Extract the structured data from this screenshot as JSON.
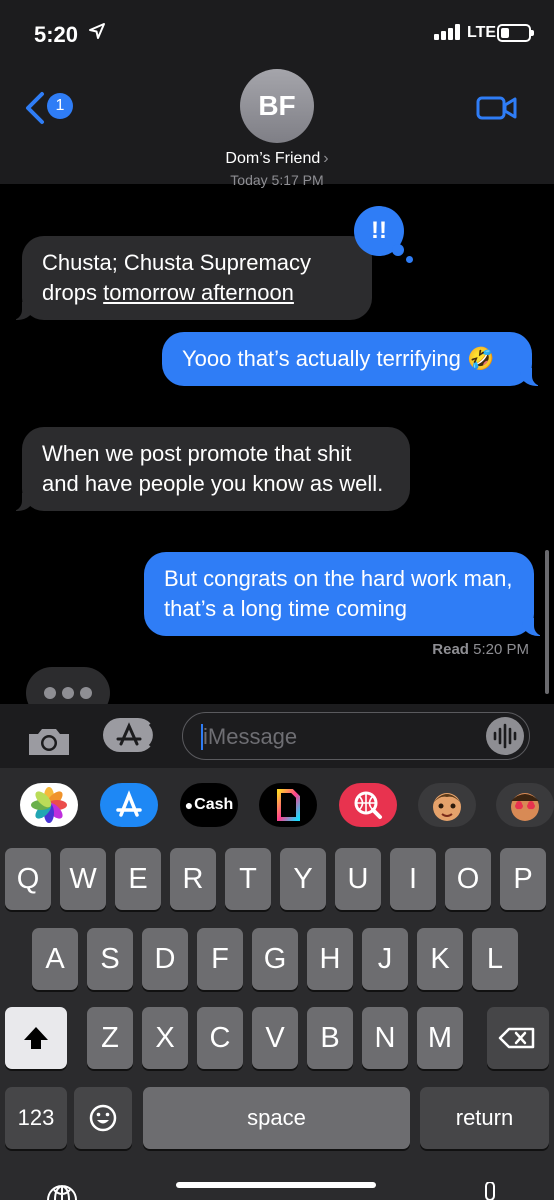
{
  "status_bar": {
    "time": "5:20",
    "network": "LTE"
  },
  "header": {
    "back_badge": "1",
    "avatar_initials": "BF",
    "contact_name": "Dom’s Friend",
    "chevron": "›"
  },
  "timestamp": "Today 5:17 PM",
  "messages": [
    {
      "direction": "incoming",
      "text_start": "Chusta; Chusta Supremacy drops ",
      "link": "tomorrow afternoon"
    },
    {
      "direction": "outgoing",
      "text": "Yooo that’s actually terrifying 🤣"
    },
    {
      "direction": "incoming",
      "text": "When we post promote that shit and have people you know as well."
    },
    {
      "direction": "outgoing",
      "text": "But congrats on the hard work man, that’s a long time coming"
    }
  ],
  "tapback": {
    "symbol": "!!",
    "color": "#2f7df6"
  },
  "read_receipt": {
    "label": "Read",
    "time": "5:20 PM"
  },
  "input": {
    "placeholder": "iMessage"
  },
  "app_strip": [
    {
      "name": "photos-icon"
    },
    {
      "name": "app-store-icon"
    },
    {
      "name": "apple-cash-icon",
      "label": "Cash"
    },
    {
      "name": "sticker-app-icon"
    },
    {
      "name": "web-search-icon"
    },
    {
      "name": "memoji-icon"
    },
    {
      "name": "memoji-stickers-icon"
    }
  ],
  "keyboard": {
    "row1": [
      "Q",
      "W",
      "E",
      "R",
      "T",
      "Y",
      "U",
      "I",
      "O",
      "P"
    ],
    "row2": [
      "A",
      "S",
      "D",
      "F",
      "G",
      "H",
      "J",
      "K",
      "L"
    ],
    "row3": [
      "Z",
      "X",
      "C",
      "V",
      "B",
      "N",
      "M"
    ],
    "numbers": "123",
    "space": "space",
    "return": "return"
  },
  "colors": {
    "accent": "#2f7df6",
    "incoming_bubble": "#2c2c2e",
    "keyboard_bg": "#2b2b2d",
    "key": "#6d6d70"
  }
}
